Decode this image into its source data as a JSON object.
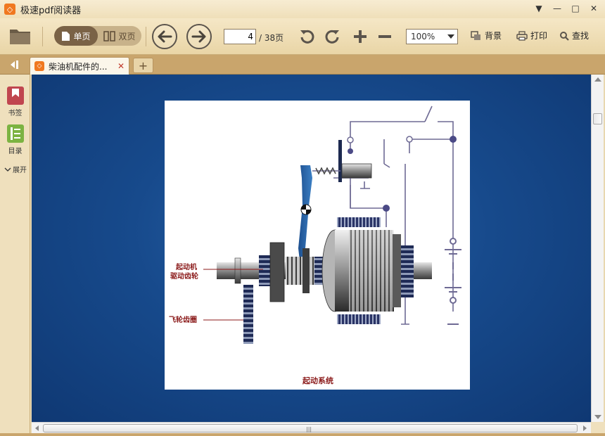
{
  "window": {
    "title": "极速pdf阅读器",
    "logo_glyph": "◇",
    "controls": {
      "menu": "▼",
      "minimize": "—",
      "maximize": "□",
      "close": "✕"
    }
  },
  "toolbar": {
    "single_page_label": "单页",
    "double_page_label": "双页",
    "current_page": "4",
    "total_pages": "/ 38页",
    "zoom_value": "100%",
    "background_label": "背景",
    "print_label": "打印",
    "search_label": "查找"
  },
  "tabs": {
    "items": [
      {
        "title": "柴油机配件的...",
        "close": "✕"
      }
    ],
    "add": "+"
  },
  "left_panel": {
    "bookmark_label": "书签",
    "toc_label": "目录",
    "expand_label": "展开"
  },
  "document": {
    "labels": {
      "starter_gear_line1": "起动机",
      "starter_gear_line2": "驱动齿轮",
      "flywheel": "飞轮齿圈",
      "caption": "起动系统"
    }
  },
  "scroll": {
    "grip": "|||"
  },
  "colors": {
    "accent": "#f07820",
    "toolbar": "#efdfb9",
    "viewer_bg": "#174a8c",
    "diagram_line": "#6e6a94",
    "diagram_label": "#8b1a1a"
  }
}
